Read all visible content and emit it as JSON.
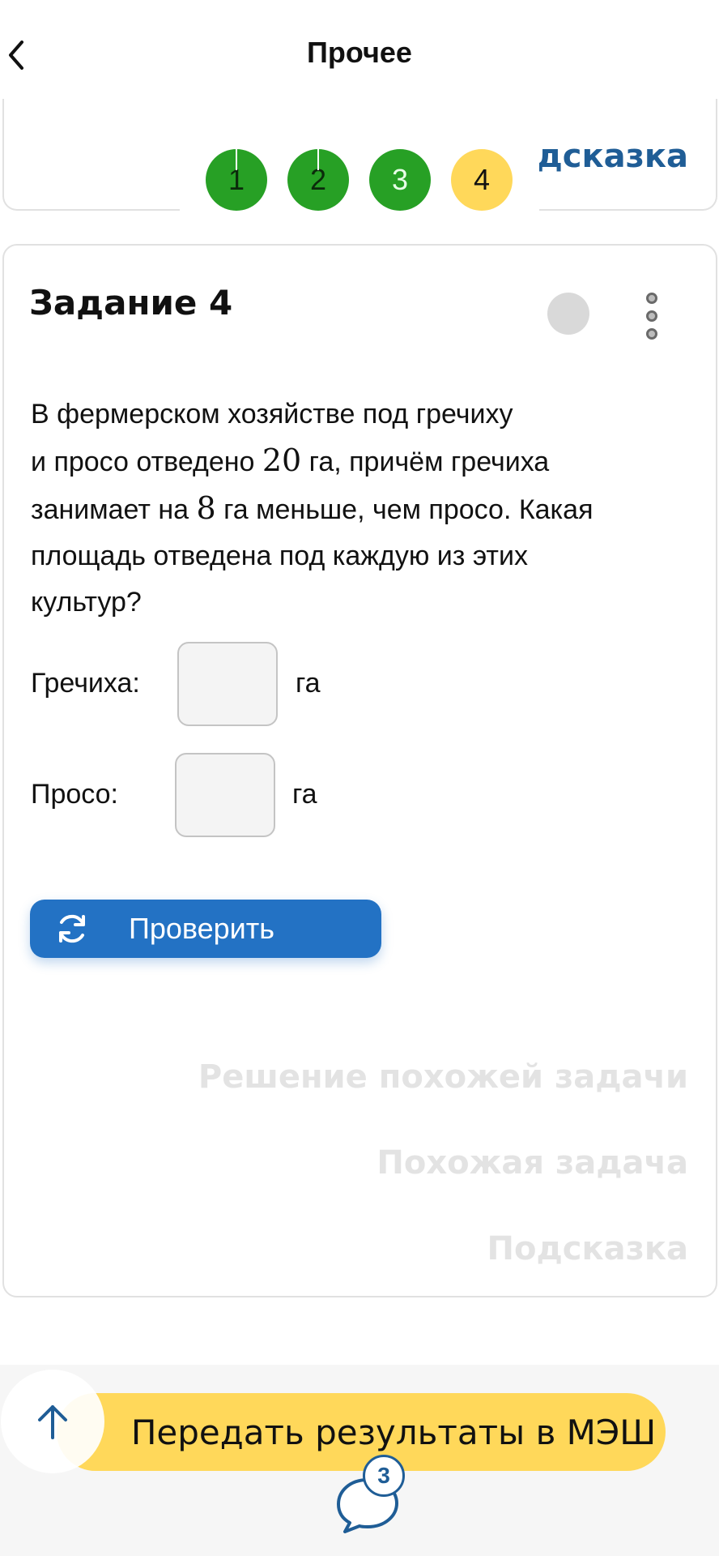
{
  "header": {
    "title": "Прочее"
  },
  "prev_card": {
    "hint_partial": "дсказка"
  },
  "steps": [
    {
      "label": "1",
      "state": "done"
    },
    {
      "label": "2",
      "state": "done"
    },
    {
      "label": "3",
      "state": "done"
    },
    {
      "label": "4",
      "state": "current"
    }
  ],
  "task": {
    "title": "Задание 4",
    "text": {
      "p1": "В фермерском хозяйстве под гречиху",
      "p2a": "и просо отведено ",
      "num1": "20",
      "p2b": " га, причём гречиха",
      "p3a": "занимает на ",
      "num2": "8",
      "p3b": " га меньше, чем просо. Какая",
      "p4": "площадь отведена под каждую из этих",
      "p5": "культур?"
    },
    "answers": [
      {
        "label": "Гречиха:",
        "unit": "га",
        "value": ""
      },
      {
        "label": "Просо:",
        "unit": "га",
        "value": ""
      }
    ],
    "check_label": "Проверить",
    "links": {
      "similar_solution": "Решение похожей задачи",
      "similar_task": "Похожая задача",
      "hint": "Подсказка"
    }
  },
  "bottom": {
    "send_label": "Передать результаты в МЭШ",
    "chat_badge": "3"
  },
  "colors": {
    "done": "#27a025",
    "current": "#ffd85a",
    "primary": "#2372c4",
    "link": "#1f5d96",
    "send": "#ffd85a"
  },
  "icons": [
    "back-arrow-icon",
    "more-vertical-icon",
    "refresh-icon",
    "arrow-up-icon",
    "chat-icon"
  ]
}
